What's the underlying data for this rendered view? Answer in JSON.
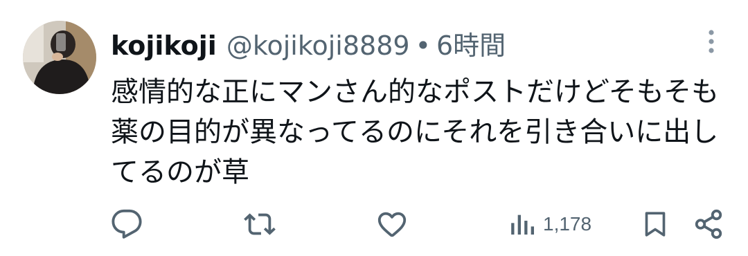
{
  "author": {
    "display_name": "kojikoji",
    "handle": "@kojikoji8889",
    "separator": "•",
    "time": "6時間"
  },
  "tweet": {
    "text": "感情的な正にマンさん的なポストだけどそもそも薬の目的が異なってるのにそれを引き合いに出してるのが草"
  },
  "actions": {
    "views": "1,178"
  },
  "icons": {
    "more": "more-vertical-icon",
    "reply": "reply-icon",
    "retweet": "retweet-icon",
    "like": "like-icon",
    "views": "views-icon",
    "bookmark": "bookmark-icon",
    "share": "share-icon"
  },
  "colors": {
    "text": "#0f1419",
    "secondary": "#536471",
    "icon": "#536471"
  }
}
